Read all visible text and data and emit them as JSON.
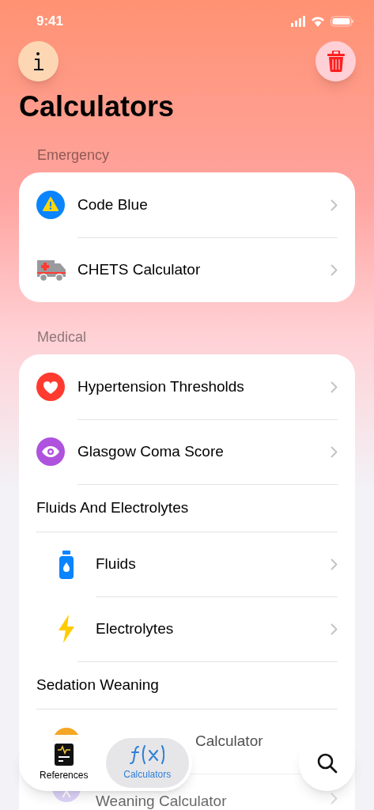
{
  "status_bar": {
    "time": "9:41"
  },
  "title": "Calculators",
  "sections": [
    {
      "header": "Emergency",
      "items": [
        {
          "kind": "row",
          "label": "Code Blue"
        },
        {
          "kind": "row",
          "label": "CHETS Calculator"
        }
      ]
    },
    {
      "header": "Medical",
      "items": [
        {
          "kind": "row",
          "label": "Hypertension Thresholds"
        },
        {
          "kind": "row",
          "label": "Glasgow Coma Score"
        },
        {
          "kind": "group",
          "label": "Fluids And Electrolytes",
          "children": [
            {
              "label": "Fluids",
              "obscured": false
            },
            {
              "label": "Electrolytes",
              "obscured": false
            }
          ]
        },
        {
          "kind": "group",
          "label": "Sedation Weaning",
          "children": [
            {
              "label": "Calculator",
              "obscured": true
            },
            {
              "label": "Weaning Calculator",
              "obscured": false
            }
          ]
        }
      ]
    }
  ],
  "tab_bar": {
    "tabs": [
      {
        "label": "References",
        "selected": false
      },
      {
        "label": "Calculators",
        "selected": true
      }
    ]
  }
}
